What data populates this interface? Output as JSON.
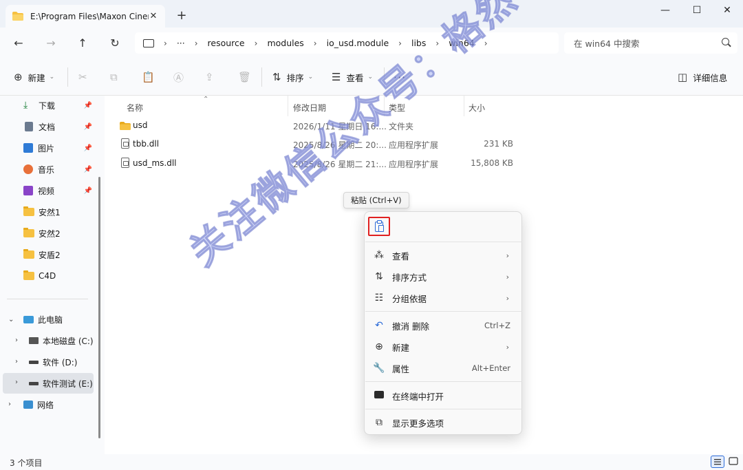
{
  "tab": {
    "title": "E:\\Program Files\\Maxon Cinen",
    "close": "✕"
  },
  "window": {
    "new_tab": "+",
    "minimize": "—",
    "maximize": "☐",
    "close": "✕"
  },
  "nav": {
    "back": "←",
    "forward": "→",
    "up": "↑",
    "refresh": "↻",
    "ellipsis": "···",
    "crumbs": [
      "resource",
      "modules",
      "io_usd.module",
      "libs",
      "win64"
    ],
    "search_placeholder": "在 win64 中搜索"
  },
  "toolbar": {
    "new_label": "新建",
    "sort_label": "排序",
    "view_label": "查看",
    "more": "···",
    "details_label": "详细信息"
  },
  "sidebar": {
    "quick": [
      {
        "label": "下载",
        "icon": "download-icon"
      },
      {
        "label": "文档",
        "icon": "document-icon"
      },
      {
        "label": "图片",
        "icon": "picture-icon"
      },
      {
        "label": "音乐",
        "icon": "music-icon"
      },
      {
        "label": "视频",
        "icon": "video-icon"
      },
      {
        "label": "安然1",
        "icon": "folder-icon"
      },
      {
        "label": "安然2",
        "icon": "folder-icon"
      },
      {
        "label": "安盾2",
        "icon": "folder-icon"
      },
      {
        "label": "C4D",
        "icon": "folder-icon"
      }
    ],
    "this_pc": "此电脑",
    "drives": [
      "本地磁盘 (C:)",
      "软件 (D:)",
      "软件测试 (E:)"
    ],
    "network": "网络"
  },
  "columns": {
    "name": "名称",
    "modified": "修改日期",
    "type": "类型",
    "size": "大小"
  },
  "files": [
    {
      "name": "usd",
      "modified": "2026/1/11 星期日 16:...",
      "type": "文件夹",
      "size": "",
      "icon": "folder-icon"
    },
    {
      "name": "tbb.dll",
      "modified": "2025/8/26 星期二 20:...",
      "type": "应用程序扩展",
      "size": "231 KB",
      "icon": "dll-icon"
    },
    {
      "name": "usd_ms.dll",
      "modified": "2025/8/26 星期二 21:...",
      "type": "应用程序扩展",
      "size": "15,808 KB",
      "icon": "dll-icon"
    }
  ],
  "status": {
    "count": "3 个项目"
  },
  "tooltip": "粘贴 (Ctrl+V)",
  "context_menu": {
    "view": "查看",
    "sort_by": "排序方式",
    "group_by": "分组依据",
    "undo": "撤消 删除",
    "undo_shortcut": "Ctrl+Z",
    "new": "新建",
    "properties": "属性",
    "properties_shortcut": "Alt+Enter",
    "open_terminal": "在终端中打开",
    "more_options": "显示更多选项"
  },
  "watermark": "关注微信公众号：格然软件管家",
  "colors": {
    "accent": "#2a6ad8",
    "highlight": "#e02020",
    "folder": "#f6c141"
  }
}
